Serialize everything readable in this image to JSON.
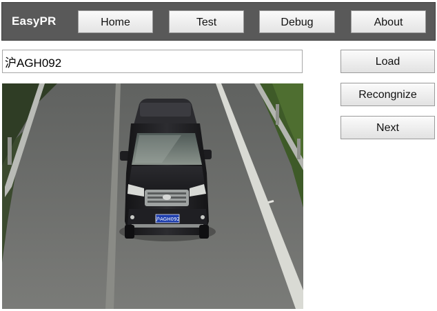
{
  "app": {
    "brand": "EasyPR"
  },
  "nav": {
    "home": "Home",
    "test": "Test",
    "debug": "Debug",
    "about": "About"
  },
  "plate_field": {
    "value": "沪AGH092"
  },
  "actions": {
    "load": "Load",
    "recognize": "Recongnize",
    "next": "Next"
  },
  "photo": {
    "subject": "dark SUV on highway",
    "plate_text": "沪AGH092"
  },
  "colors": {
    "navbar": "#595959",
    "brand_text": "#ffffff",
    "button_face": "#eeeeee",
    "plate_background": "#1f3fae"
  }
}
